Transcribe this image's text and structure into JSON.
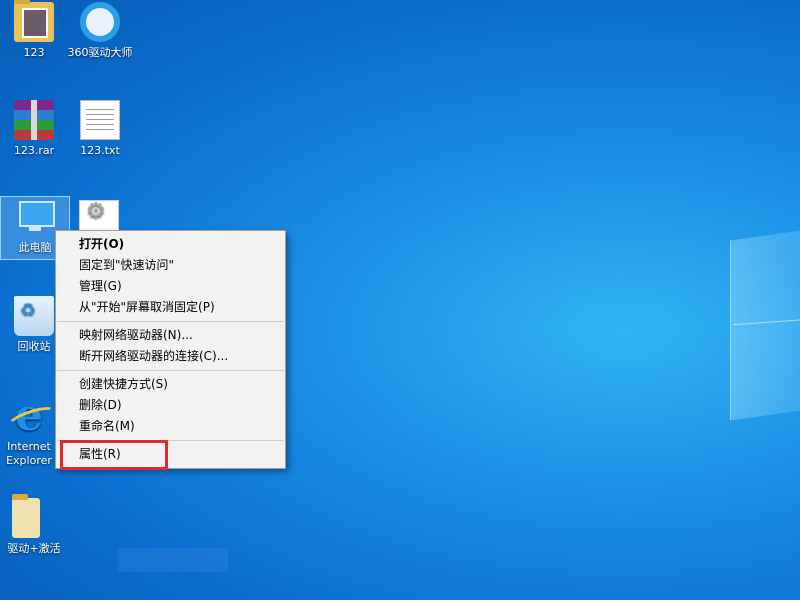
{
  "desktop": {
    "icons": [
      {
        "label": "123",
        "icon": "folder-icon"
      },
      {
        "label": "360驱动大师",
        "icon": "driver-master-icon"
      },
      {
        "label": "123.rar",
        "icon": "rar-archive-icon"
      },
      {
        "label": "123.txt",
        "icon": "text-file-icon"
      },
      {
        "label": "此电脑",
        "icon": "this-pc-icon"
      },
      {
        "label": "",
        "icon": "settings-file-icon"
      },
      {
        "label": "回收站",
        "icon": "recycle-bin-icon"
      },
      {
        "label": "Internet Explorer",
        "icon": "internet-explorer-icon"
      },
      {
        "label": "驱动+激活",
        "icon": "folder-icon"
      }
    ]
  },
  "context_menu": {
    "items": [
      {
        "label": "打开(O)",
        "bold": true
      },
      {
        "label": "固定到\"快速访问\""
      },
      {
        "label": "管理(G)"
      },
      {
        "label": "从\"开始\"屏幕取消固定(P)"
      },
      {
        "label": "映射网络驱动器(N)..."
      },
      {
        "label": "断开网络驱动器的连接(C)..."
      },
      {
        "label": "创建快捷方式(S)"
      },
      {
        "label": "删除(D)"
      },
      {
        "label": "重命名(M)"
      },
      {
        "label": "属性(R)"
      }
    ]
  },
  "annotation": {
    "color": "#e02a2a",
    "target": "属性(R)"
  },
  "colors": {
    "desktop_blue": "#0b6fd0",
    "menu_bg": "#f2f2f2"
  }
}
